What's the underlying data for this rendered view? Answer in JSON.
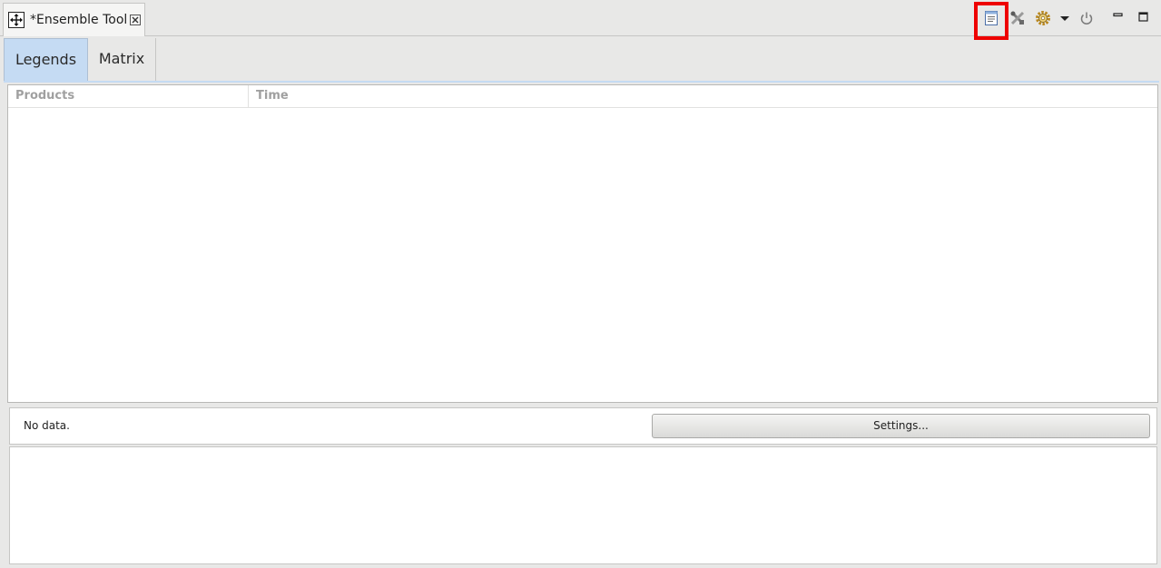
{
  "view": {
    "tab_title": "*Ensemble Tool",
    "tab_icon": "move-arrows-icon",
    "close_icon": "close-icon"
  },
  "toolbar": {
    "buttons": [
      {
        "icon": "document-icon",
        "highlighted": true
      },
      {
        "icon": "tools-cross-icon",
        "highlighted": false
      },
      {
        "icon": "gear-icon",
        "highlighted": false
      },
      {
        "icon": "dropdown-arrow-icon",
        "highlighted": false
      },
      {
        "icon": "power-icon",
        "highlighted": false
      },
      {
        "icon": "minimize-icon",
        "highlighted": false
      },
      {
        "icon": "maximize-icon",
        "highlighted": false
      }
    ],
    "highlight_color": "#ee0000"
  },
  "tabs": [
    {
      "label": "Legends",
      "active": true
    },
    {
      "label": "Matrix",
      "active": false
    }
  ],
  "table": {
    "columns": [
      "Products",
      "Time"
    ],
    "rows": []
  },
  "status": {
    "text": "No data.",
    "settings_label": "Settings..."
  },
  "colors": {
    "active_tab": "#c5dbf3",
    "background": "#e8e8e7"
  }
}
